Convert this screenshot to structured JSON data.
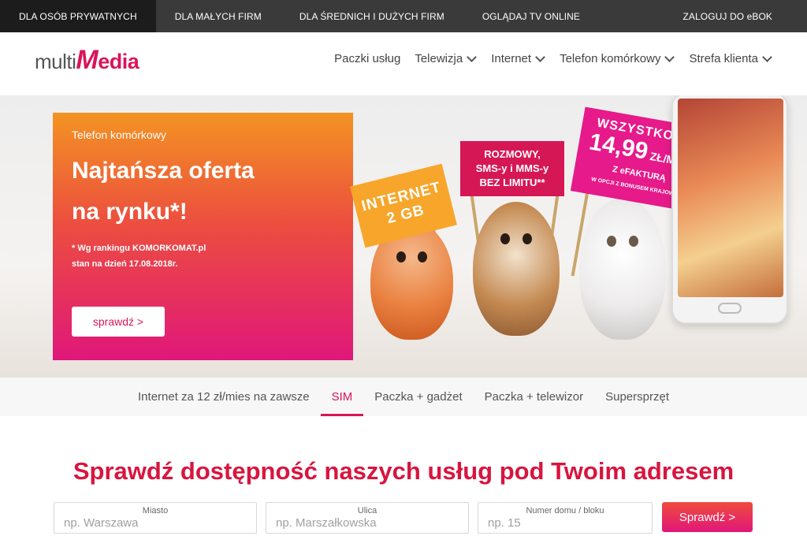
{
  "topbar": {
    "items": [
      "DLA OSÓB PRYWATNYCH",
      "DLA MAŁYCH FIRM",
      "DLA ŚREDNICH I DUŻYCH FIRM",
      "OGLĄDAJ TV ONLINE"
    ],
    "login": "ZALOGUJ DO eBOK"
  },
  "logo": {
    "multi": "multi",
    "media_m": "M",
    "media_rest": "edia"
  },
  "nav": {
    "items": [
      "Paczki usług",
      "Telewizja",
      "Internet",
      "Telefon komórkowy",
      "Strefa klienta"
    ]
  },
  "hero": {
    "eyebrow": "Telefon komórkowy",
    "headline_1": "Najtańsza oferta",
    "headline_2": "na rynku*!",
    "note_1": "* Wg rankingu KOMORKOMAT.pl",
    "note_2": "stan na dzień 17.08.2018r.",
    "cta": "sprawdź  >",
    "sign_internet_1": "INTERNET",
    "sign_internet_2": "2 GB",
    "sign_calls_1": "ROZMOWY,",
    "sign_calls_2": "SMS-y i MMS-y",
    "sign_calls_3": "BEZ LIMITU**",
    "sign_price_1": "WSZYSTKO ZA",
    "sign_price_2": "14,99",
    "sign_price_unit": " ZŁ/MIES.",
    "sign_price_3": "Z eFAKTURĄ",
    "sign_price_4": "W OPCJI Z BONUSEM KRAJOWYM"
  },
  "tabs": {
    "items": [
      "Internet za 12 zł/mies na zawsze",
      "SIM",
      "Paczka + gadżet",
      "Paczka + telewizor",
      "Supersprzęt"
    ],
    "active": "SIM"
  },
  "address": {
    "title": "Sprawdź dostępność naszych usług pod Twoim adresem",
    "city_label": "Miasto",
    "city_placeholder": "np. Warszawa",
    "street_label": "Ulica",
    "street_placeholder": "np. Marszałkowska",
    "number_label": "Numer domu / bloku",
    "number_placeholder": "np. 15",
    "submit": "Sprawdź >"
  },
  "colors": {
    "brand": "#d8155a",
    "topbar": "#3a3a3a"
  }
}
